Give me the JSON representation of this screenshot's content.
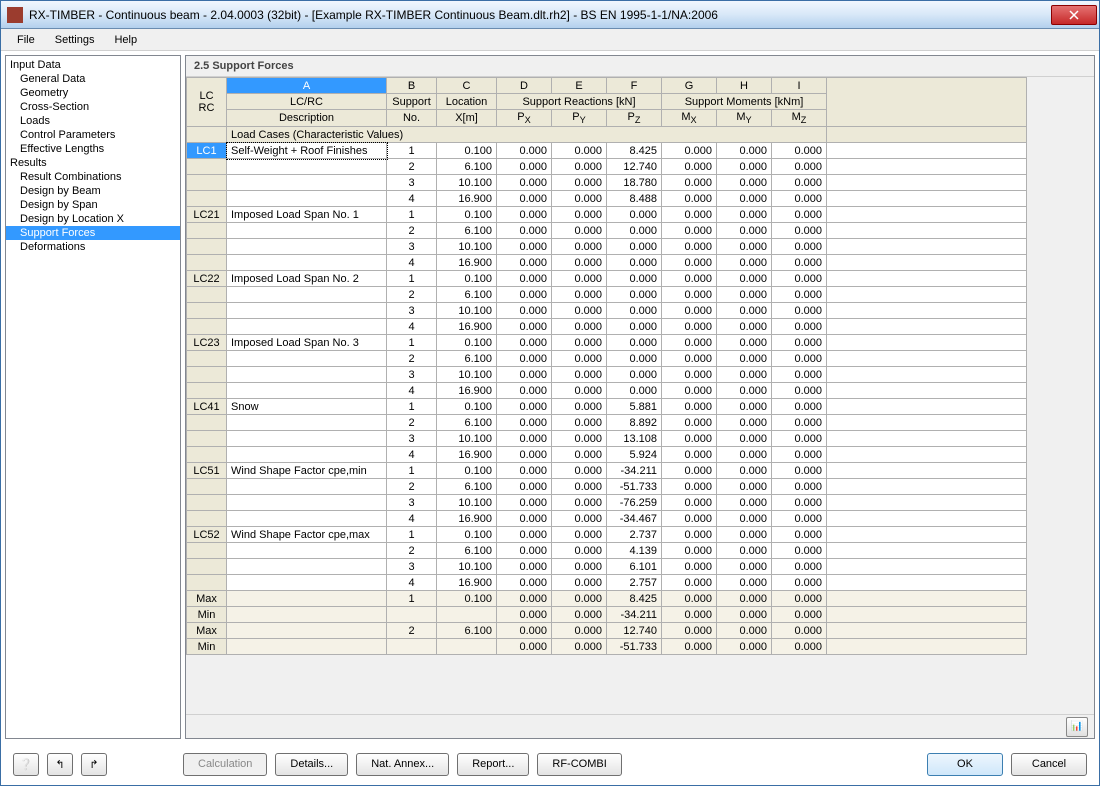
{
  "window": {
    "title": "RX-TIMBER - Continuous beam - 2.04.0003 (32bit) - [Example RX-TIMBER Continuous Beam.dlt.rh2] - BS EN 1995-1-1/NA:2006"
  },
  "menu": {
    "file": "File",
    "settings": "Settings",
    "help": "Help"
  },
  "tree": {
    "input_data": "Input Data",
    "general_data": "General Data",
    "geometry": "Geometry",
    "cross_section": "Cross-Section",
    "loads": "Loads",
    "control_parameters": "Control Parameters",
    "effective_lengths": "Effective Lengths",
    "results": "Results",
    "result_combinations": "Result Combinations",
    "design_by_beam": "Design by Beam",
    "design_by_span": "Design by Span",
    "design_by_location_x": "Design by Location X",
    "support_forces": "Support Forces",
    "deformations": "Deformations"
  },
  "section_title": "2.5 Support Forces",
  "columns": {
    "letters": [
      "A",
      "B",
      "C",
      "D",
      "E",
      "F",
      "G",
      "H",
      "I"
    ],
    "lc_rc1": "LC",
    "lc_rc2": "RC",
    "group1": "LC/RC",
    "group1b": "Description",
    "support": "Support",
    "support_no": "No.",
    "location": "Location",
    "location_x": "X[m]",
    "reactions": "Support Reactions [kN]",
    "px": "Pₓ",
    "py": "Pᵧ",
    "pz": "P_Z",
    "moments": "Support Moments [kNm]",
    "mx": "Mₓ",
    "my": "Mᵧ",
    "mz": "M_Z"
  },
  "section_row": "Load Cases (Characteristic Values)",
  "rows": [
    {
      "lc": "LC1",
      "desc": "Self-Weight + Roof Finishes",
      "sup": "1",
      "x": "0.100",
      "px": "0.000",
      "py": "0.000",
      "pz": "8.425",
      "mx": "0.000",
      "my": "0.000",
      "mz": "0.000",
      "sel": true
    },
    {
      "lc": "",
      "desc": "",
      "sup": "2",
      "x": "6.100",
      "px": "0.000",
      "py": "0.000",
      "pz": "12.740",
      "mx": "0.000",
      "my": "0.000",
      "mz": "0.000"
    },
    {
      "lc": "",
      "desc": "",
      "sup": "3",
      "x": "10.100",
      "px": "0.000",
      "py": "0.000",
      "pz": "18.780",
      "mx": "0.000",
      "my": "0.000",
      "mz": "0.000"
    },
    {
      "lc": "",
      "desc": "",
      "sup": "4",
      "x": "16.900",
      "px": "0.000",
      "py": "0.000",
      "pz": "8.488",
      "mx": "0.000",
      "my": "0.000",
      "mz": "0.000"
    },
    {
      "lc": "LC21",
      "desc": "Imposed Load Span No. 1",
      "sup": "1",
      "x": "0.100",
      "px": "0.000",
      "py": "0.000",
      "pz": "0.000",
      "mx": "0.000",
      "my": "0.000",
      "mz": "0.000"
    },
    {
      "lc": "",
      "desc": "",
      "sup": "2",
      "x": "6.100",
      "px": "0.000",
      "py": "0.000",
      "pz": "0.000",
      "mx": "0.000",
      "my": "0.000",
      "mz": "0.000"
    },
    {
      "lc": "",
      "desc": "",
      "sup": "3",
      "x": "10.100",
      "px": "0.000",
      "py": "0.000",
      "pz": "0.000",
      "mx": "0.000",
      "my": "0.000",
      "mz": "0.000"
    },
    {
      "lc": "",
      "desc": "",
      "sup": "4",
      "x": "16.900",
      "px": "0.000",
      "py": "0.000",
      "pz": "0.000",
      "mx": "0.000",
      "my": "0.000",
      "mz": "0.000"
    },
    {
      "lc": "LC22",
      "desc": "Imposed Load Span No. 2",
      "sup": "1",
      "x": "0.100",
      "px": "0.000",
      "py": "0.000",
      "pz": "0.000",
      "mx": "0.000",
      "my": "0.000",
      "mz": "0.000"
    },
    {
      "lc": "",
      "desc": "",
      "sup": "2",
      "x": "6.100",
      "px": "0.000",
      "py": "0.000",
      "pz": "0.000",
      "mx": "0.000",
      "my": "0.000",
      "mz": "0.000"
    },
    {
      "lc": "",
      "desc": "",
      "sup": "3",
      "x": "10.100",
      "px": "0.000",
      "py": "0.000",
      "pz": "0.000",
      "mx": "0.000",
      "my": "0.000",
      "mz": "0.000"
    },
    {
      "lc": "",
      "desc": "",
      "sup": "4",
      "x": "16.900",
      "px": "0.000",
      "py": "0.000",
      "pz": "0.000",
      "mx": "0.000",
      "my": "0.000",
      "mz": "0.000"
    },
    {
      "lc": "LC23",
      "desc": "Imposed Load Span No. 3",
      "sup": "1",
      "x": "0.100",
      "px": "0.000",
      "py": "0.000",
      "pz": "0.000",
      "mx": "0.000",
      "my": "0.000",
      "mz": "0.000"
    },
    {
      "lc": "",
      "desc": "",
      "sup": "2",
      "x": "6.100",
      "px": "0.000",
      "py": "0.000",
      "pz": "0.000",
      "mx": "0.000",
      "my": "0.000",
      "mz": "0.000"
    },
    {
      "lc": "",
      "desc": "",
      "sup": "3",
      "x": "10.100",
      "px": "0.000",
      "py": "0.000",
      "pz": "0.000",
      "mx": "0.000",
      "my": "0.000",
      "mz": "0.000"
    },
    {
      "lc": "",
      "desc": "",
      "sup": "4",
      "x": "16.900",
      "px": "0.000",
      "py": "0.000",
      "pz": "0.000",
      "mx": "0.000",
      "my": "0.000",
      "mz": "0.000"
    },
    {
      "lc": "LC41",
      "desc": "Snow",
      "sup": "1",
      "x": "0.100",
      "px": "0.000",
      "py": "0.000",
      "pz": "5.881",
      "mx": "0.000",
      "my": "0.000",
      "mz": "0.000"
    },
    {
      "lc": "",
      "desc": "",
      "sup": "2",
      "x": "6.100",
      "px": "0.000",
      "py": "0.000",
      "pz": "8.892",
      "mx": "0.000",
      "my": "0.000",
      "mz": "0.000"
    },
    {
      "lc": "",
      "desc": "",
      "sup": "3",
      "x": "10.100",
      "px": "0.000",
      "py": "0.000",
      "pz": "13.108",
      "mx": "0.000",
      "my": "0.000",
      "mz": "0.000"
    },
    {
      "lc": "",
      "desc": "",
      "sup": "4",
      "x": "16.900",
      "px": "0.000",
      "py": "0.000",
      "pz": "5.924",
      "mx": "0.000",
      "my": "0.000",
      "mz": "0.000"
    },
    {
      "lc": "LC51",
      "desc": "Wind Shape Factor cpe,min",
      "sup": "1",
      "x": "0.100",
      "px": "0.000",
      "py": "0.000",
      "pz": "-34.211",
      "mx": "0.000",
      "my": "0.000",
      "mz": "0.000"
    },
    {
      "lc": "",
      "desc": "",
      "sup": "2",
      "x": "6.100",
      "px": "0.000",
      "py": "0.000",
      "pz": "-51.733",
      "mx": "0.000",
      "my": "0.000",
      "mz": "0.000"
    },
    {
      "lc": "",
      "desc": "",
      "sup": "3",
      "x": "10.100",
      "px": "0.000",
      "py": "0.000",
      "pz": "-76.259",
      "mx": "0.000",
      "my": "0.000",
      "mz": "0.000"
    },
    {
      "lc": "",
      "desc": "",
      "sup": "4",
      "x": "16.900",
      "px": "0.000",
      "py": "0.000",
      "pz": "-34.467",
      "mx": "0.000",
      "my": "0.000",
      "mz": "0.000"
    },
    {
      "lc": "LC52",
      "desc": "Wind Shape Factor cpe,max",
      "sup": "1",
      "x": "0.100",
      "px": "0.000",
      "py": "0.000",
      "pz": "2.737",
      "mx": "0.000",
      "my": "0.000",
      "mz": "0.000"
    },
    {
      "lc": "",
      "desc": "",
      "sup": "2",
      "x": "6.100",
      "px": "0.000",
      "py": "0.000",
      "pz": "4.139",
      "mx": "0.000",
      "my": "0.000",
      "mz": "0.000"
    },
    {
      "lc": "",
      "desc": "",
      "sup": "3",
      "x": "10.100",
      "px": "0.000",
      "py": "0.000",
      "pz": "6.101",
      "mx": "0.000",
      "my": "0.000",
      "mz": "0.000"
    },
    {
      "lc": "",
      "desc": "",
      "sup": "4",
      "x": "16.900",
      "px": "0.000",
      "py": "0.000",
      "pz": "2.757",
      "mx": "0.000",
      "my": "0.000",
      "mz": "0.000"
    },
    {
      "lc": "Max",
      "desc": "",
      "sup": "1",
      "x": "0.100",
      "px": "0.000",
      "py": "0.000",
      "pz": "8.425",
      "mx": "0.000",
      "my": "0.000",
      "mz": "0.000",
      "summary": true
    },
    {
      "lc": "Min",
      "desc": "",
      "sup": "",
      "x": "",
      "px": "0.000",
      "py": "0.000",
      "pz": "-34.211",
      "mx": "0.000",
      "my": "0.000",
      "mz": "0.000",
      "summary": true
    },
    {
      "lc": "Max",
      "desc": "",
      "sup": "2",
      "x": "6.100",
      "px": "0.000",
      "py": "0.000",
      "pz": "12.740",
      "mx": "0.000",
      "my": "0.000",
      "mz": "0.000",
      "summary": true
    },
    {
      "lc": "Min",
      "desc": "",
      "sup": "",
      "x": "",
      "px": "0.000",
      "py": "0.000",
      "pz": "-51.733",
      "mx": "0.000",
      "my": "0.000",
      "mz": "0.000",
      "summary": true
    }
  ],
  "buttons": {
    "calculation": "Calculation",
    "details": "Details...",
    "nat_annex": "Nat. Annex...",
    "report": "Report...",
    "rf_combi": "RF-COMBI",
    "ok": "OK",
    "cancel": "Cancel"
  }
}
